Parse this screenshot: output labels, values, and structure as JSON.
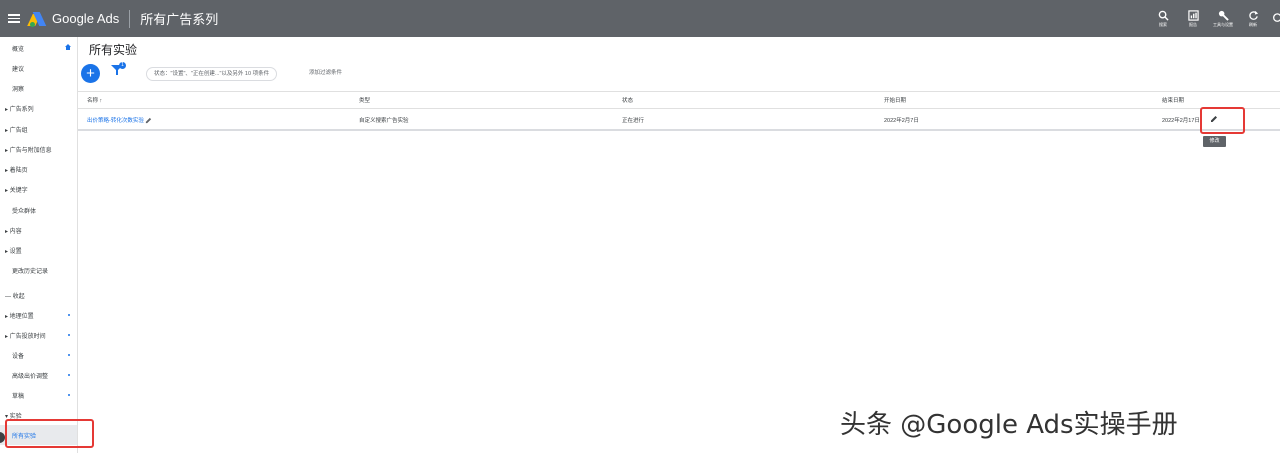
{
  "topbar": {
    "brand": "Google Ads",
    "crumb": "所有广告系列",
    "tools": [
      "搜索",
      "报告",
      "工具与设置",
      "刷新"
    ]
  },
  "sidebar": {
    "items": [
      {
        "label": "概览"
      },
      {
        "label": "建议"
      },
      {
        "label": "洞察"
      },
      {
        "label": "▸ 广告系列"
      },
      {
        "label": "▸ 广告组"
      },
      {
        "label": "▸ 广告与附加信息"
      },
      {
        "label": "▸ 着陆页"
      },
      {
        "label": "▸ 关键字"
      },
      {
        "label": "受众群体"
      },
      {
        "label": "▸ 内容"
      },
      {
        "label": "▸ 设置"
      },
      {
        "label": "更改历史记录"
      },
      {
        "label": "— 收起"
      },
      {
        "label": "▸ 地理位置"
      },
      {
        "label": "▸ 广告投放时间"
      },
      {
        "label": "设备"
      },
      {
        "label": "高级出价调整"
      },
      {
        "label": "草稿"
      },
      {
        "label": "▾ 实验"
      },
      {
        "label": "所有实验"
      }
    ]
  },
  "main": {
    "title": "所有实验",
    "add_label": "+",
    "filter_badge": "1",
    "filter_chip": "状态：\"设置\"、\"正在创建...\"以及另外 10 项条件",
    "add_filter": "添加过滤条件",
    "columns": [
      "名称 ↑",
      "类型",
      "状态",
      "开始日期",
      "结束日期"
    ],
    "row": {
      "name": "出价策略-转化次数实验",
      "type": "自定义搜索广告实验",
      "status": "正在进行",
      "start": "2022年2月7日",
      "end": "2022年2月17日"
    },
    "tooltip": "修改"
  },
  "watermark": "头条 @Google Ads实操手册",
  "colors": {
    "topbar": "#5f6368",
    "accent": "#1a73e8",
    "highlight": "#e53935"
  }
}
